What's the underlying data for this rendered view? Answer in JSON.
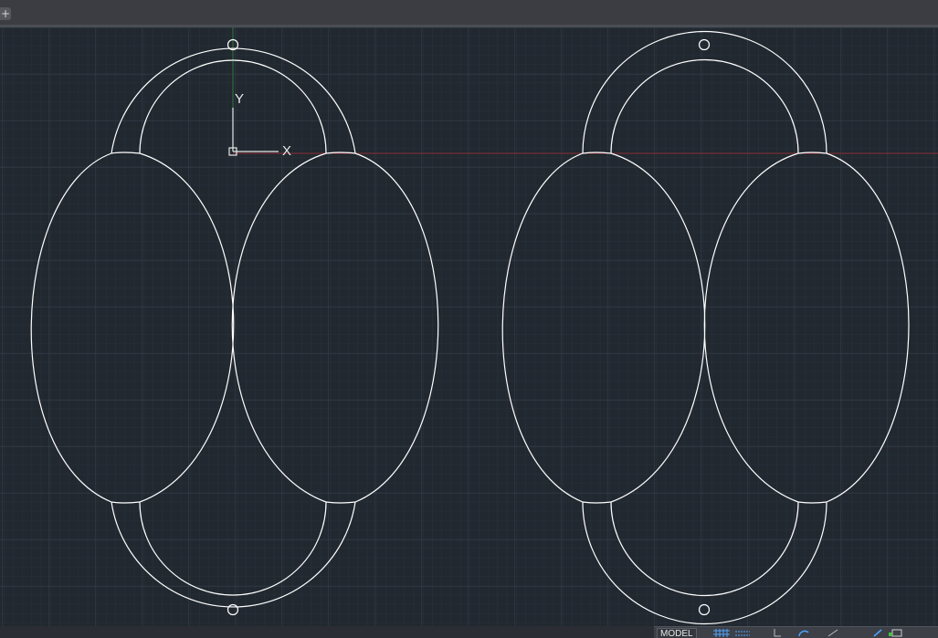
{
  "tabbar": {
    "new_tab_label": "+"
  },
  "ucs": {
    "x_label": "X",
    "y_label": "Y"
  },
  "statusbar": {
    "model_label": "MODEL",
    "buttons": [
      {
        "name": "grid-toggle",
        "icon": "grid-icon"
      },
      {
        "name": "snap-toggle",
        "icon": "snap-icon"
      },
      {
        "name": "ortho-toggle",
        "icon": "ortho-icon"
      },
      {
        "name": "polar-toggle",
        "icon": "polar-icon"
      },
      {
        "name": "osnap-toggle",
        "icon": "osnap-icon"
      },
      {
        "name": "annotation-toggle",
        "icon": "annotation-icon"
      },
      {
        "name": "workspace-toggle",
        "icon": "workspace-icon"
      }
    ]
  },
  "colors": {
    "canvas_bg": "#212830",
    "grid_minor": "#29313a",
    "grid_major": "#36404b",
    "geometry": "#ffffff",
    "x_axis": "#8a2f36",
    "y_axis": "#2f7a3a",
    "statusbar_active": "#4da3ff"
  }
}
